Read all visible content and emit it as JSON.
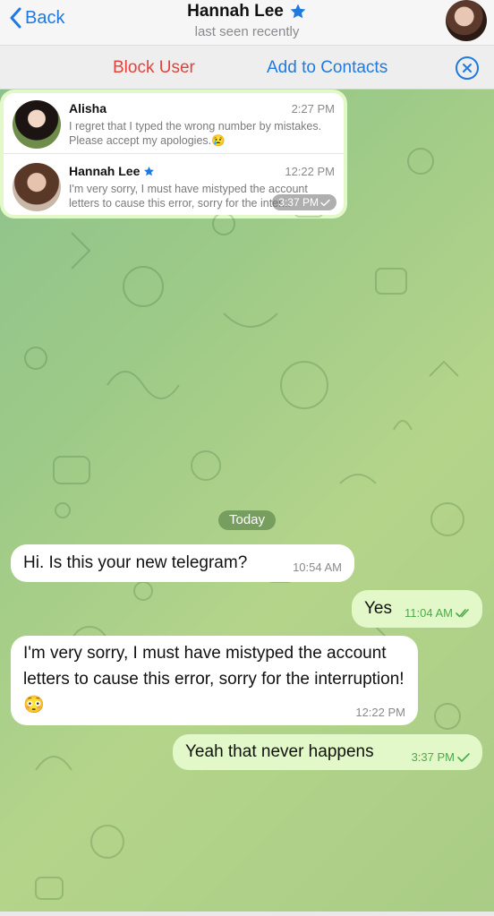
{
  "header": {
    "back_label": "Back",
    "contact_name": "Hannah Lee",
    "status": "last seen recently"
  },
  "actions": {
    "block_label": "Block User",
    "add_label": "Add to Contacts"
  },
  "chat": {
    "date_label": "Today",
    "messages": [
      {
        "direction": "in",
        "text": "Hi. Is this your new telegram?",
        "time": "10:54 AM"
      },
      {
        "direction": "out",
        "text": "Yes",
        "time": "11:04 AM",
        "read": true
      },
      {
        "direction": "in",
        "text": "I'm very sorry, I must have mistyped the account letters to cause this error, sorry for the interruption! 😳",
        "time": "12:22 PM"
      },
      {
        "direction": "out",
        "text": "Yeah that never happens",
        "time": "3:37 PM",
        "read": false
      }
    ],
    "forwarded_image": {
      "time": "3:37 PM",
      "rows": [
        {
          "name": "Alisha",
          "time": "2:27 PM",
          "message": "I regret that I typed the wrong number by mistakes. Please accept my apologies.😢"
        },
        {
          "name": "Hannah Lee",
          "time": "12:22 PM",
          "message": "I'm very sorry, I must have mistyped the account letters to cause this error, sorry for the inter..."
        }
      ]
    }
  },
  "colors": {
    "accent": "#1f7ae0",
    "danger": "#e5413a",
    "outgoing_bubble": "#e3f8c9",
    "read_check": "#4fa84b"
  }
}
